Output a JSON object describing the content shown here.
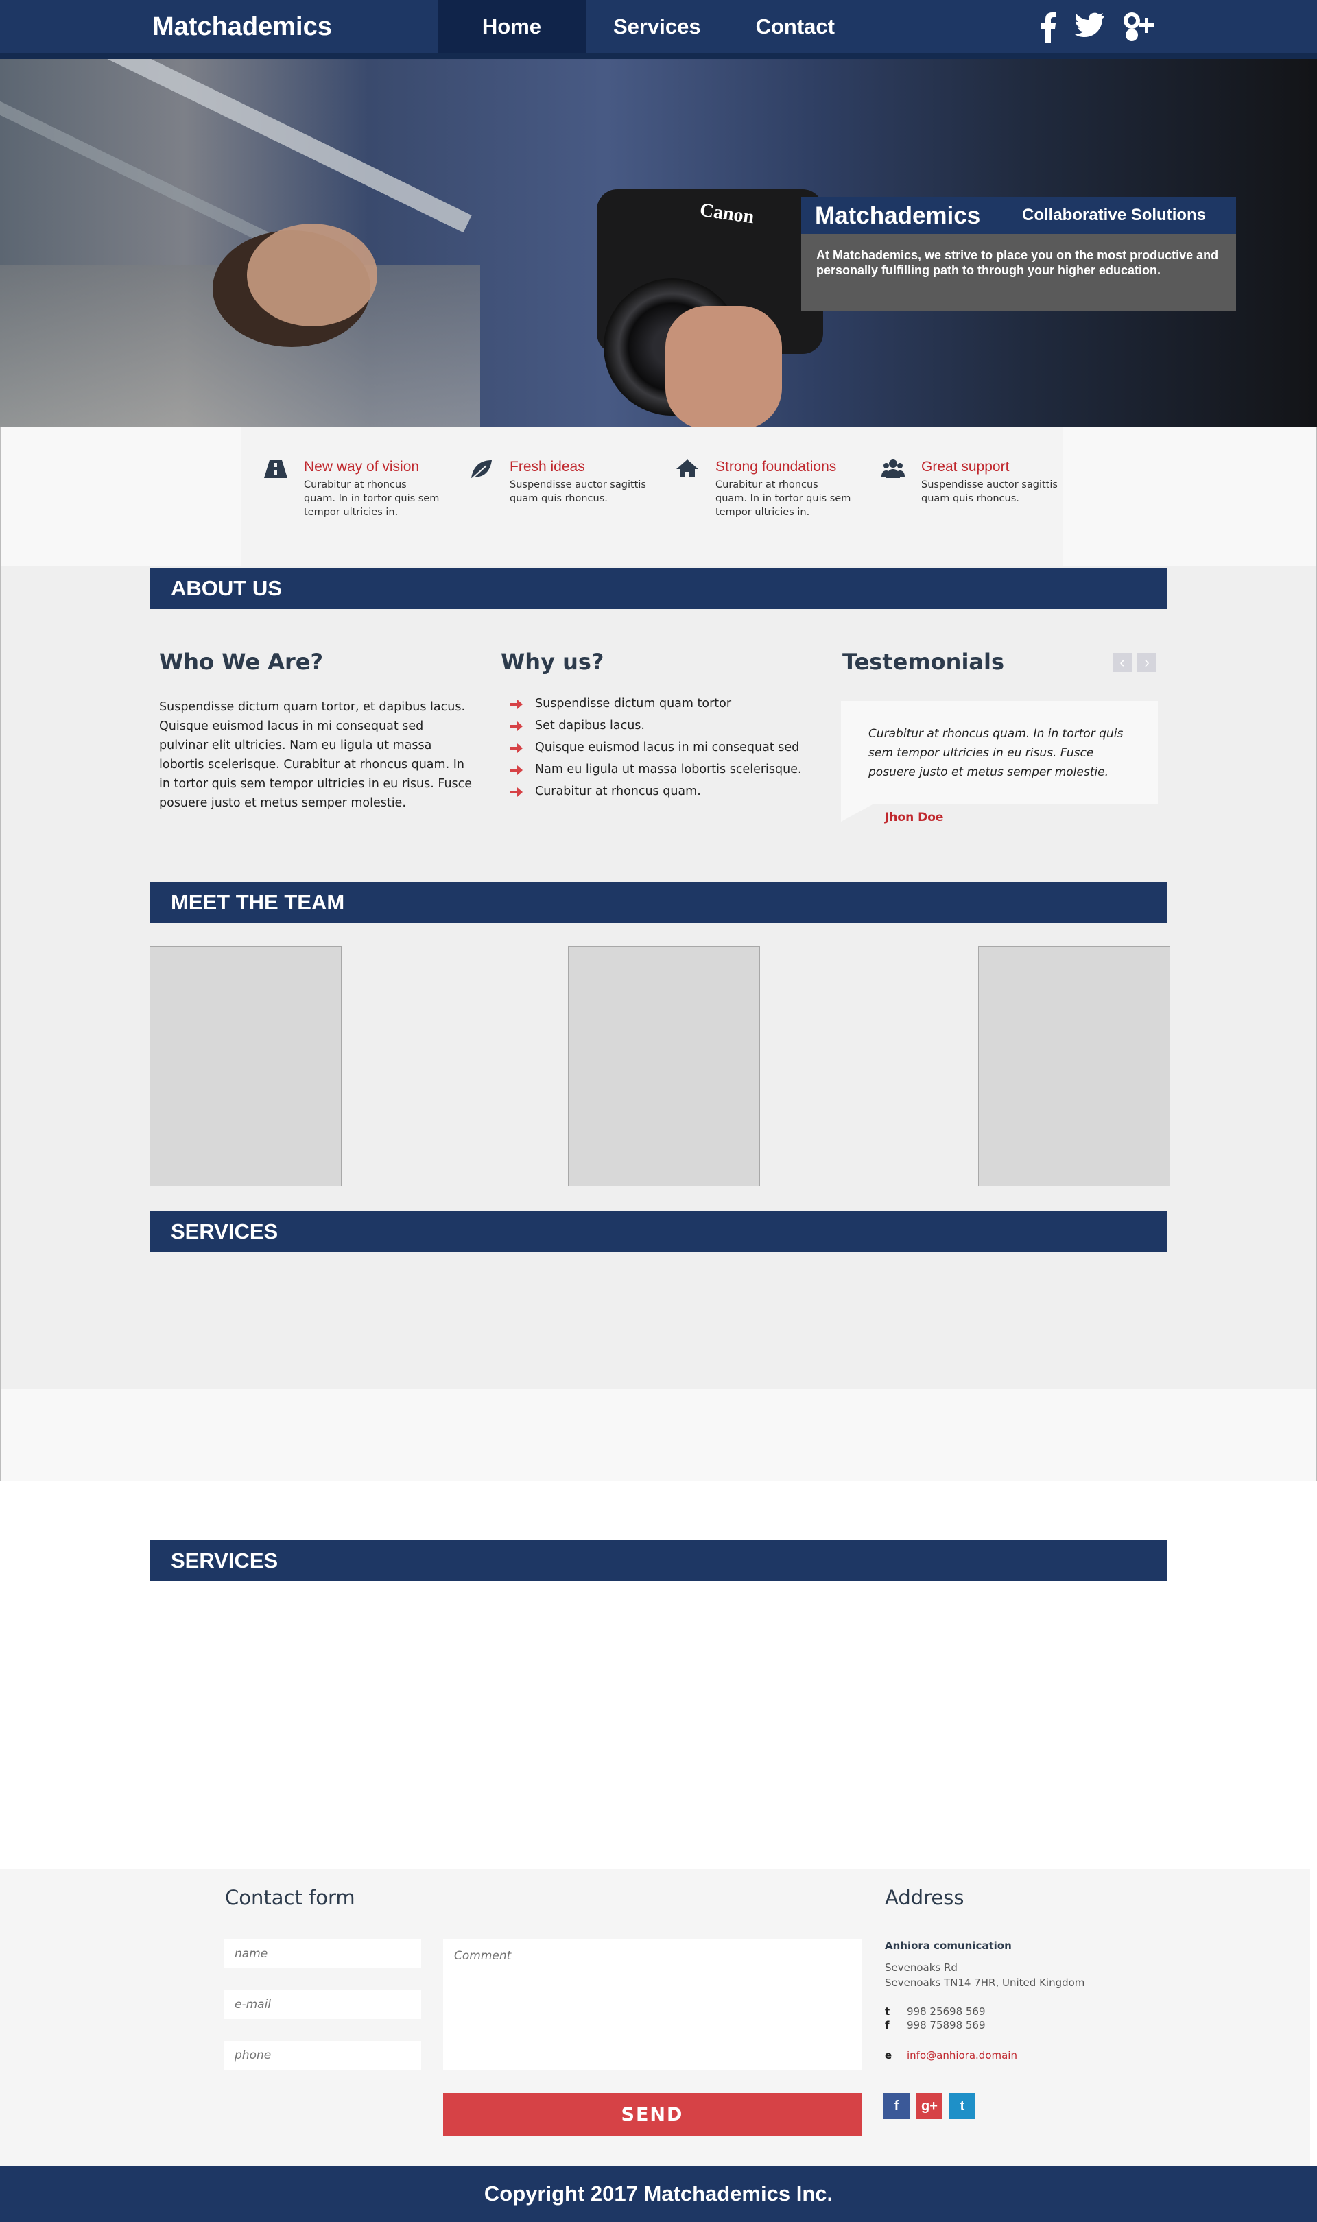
{
  "nav": {
    "brand": "Matchademics",
    "items": [
      {
        "label": "Home",
        "active": true
      },
      {
        "label": "Services",
        "active": false
      },
      {
        "label": "Contact",
        "active": false
      }
    ],
    "social_icons": [
      "facebook-icon",
      "twitter-icon",
      "google-plus-icon"
    ]
  },
  "hero": {
    "camera_brand": "Canon",
    "box_title": "Matchademics",
    "box_subtitle": "Collaborative Solutions",
    "box_text": "At Matchademics, we strive to place you on the most productive and personally fulfilling path to through your higher education."
  },
  "features": [
    {
      "icon": "road-icon",
      "title": "New way of vision",
      "text": "Curabitur at rhoncus quam. In in tortor quis sem tempor ultricies in."
    },
    {
      "icon": "leaf-icon",
      "title": "Fresh ideas",
      "text": "Suspendisse auctor sagittis quam quis rhoncus."
    },
    {
      "icon": "home-icon",
      "title": "Strong foundations",
      "text": "Curabitur at rhoncus quam. In in tortor quis sem tempor ultricies in."
    },
    {
      "icon": "users-icon",
      "title": "Great support",
      "text": "Suspendisse auctor sagittis quam quis rhoncus."
    }
  ],
  "about": {
    "bar": "ABOUT US",
    "who_title": "Who We Are?",
    "who_text": "Suspendisse dictum quam tortor, et dapibus lacus. Quisque euismod lacus in mi consequat sed pulvinar elit ultricies. Nam eu ligula ut massa lobortis scelerisque. Curabitur at rhoncus quam. In in tortor quis sem tempor ultricies in eu risus. Fusce posuere justo et metus semper molestie.",
    "why_title": "Why us?",
    "why_items": [
      "Suspendisse dictum quam tortor",
      "Set dapibus lacus.",
      "Quisque euismod lacus in mi consequat sed",
      "Nam eu ligula ut massa lobortis scelerisque.",
      "Curabitur at rhoncus quam."
    ],
    "test_title": "Testemonials",
    "prev": "‹",
    "next": "›",
    "quote": "Curabitur at rhoncus quam. In in tortor quis sem tempor ultricies in eu risus. Fusce posuere justo et metus semper molestie.",
    "author": "Jhon Doe"
  },
  "team": {
    "bar": "MEET THE TEAM"
  },
  "services": {
    "bar": "SERVICES",
    "bar2": "SERVICES"
  },
  "contact": {
    "title": "Contact form",
    "name_placeholder": "name",
    "email_placeholder": "e-mail",
    "phone_placeholder": "phone",
    "comment_placeholder": "Comment",
    "send": "SEND"
  },
  "address": {
    "title": "Address",
    "company": "Anhiora comunication",
    "line1": "Sevenoaks Rd",
    "line2": "Sevenoaks TN14 7HR, United Kingdom",
    "t_label": "t",
    "t_value": "998 25698 569",
    "f_label": "f",
    "f_value": "998 75898 569",
    "e_label": "e",
    "e_value": "info@anhiora.domain",
    "social": [
      "f",
      "g+",
      "t"
    ]
  },
  "footer": {
    "copyright": "Copyright 2017 Matchademics Inc."
  },
  "colors": {
    "navy": "#1e3764",
    "accent_red": "#c0282e",
    "send_red": "#d64246"
  }
}
